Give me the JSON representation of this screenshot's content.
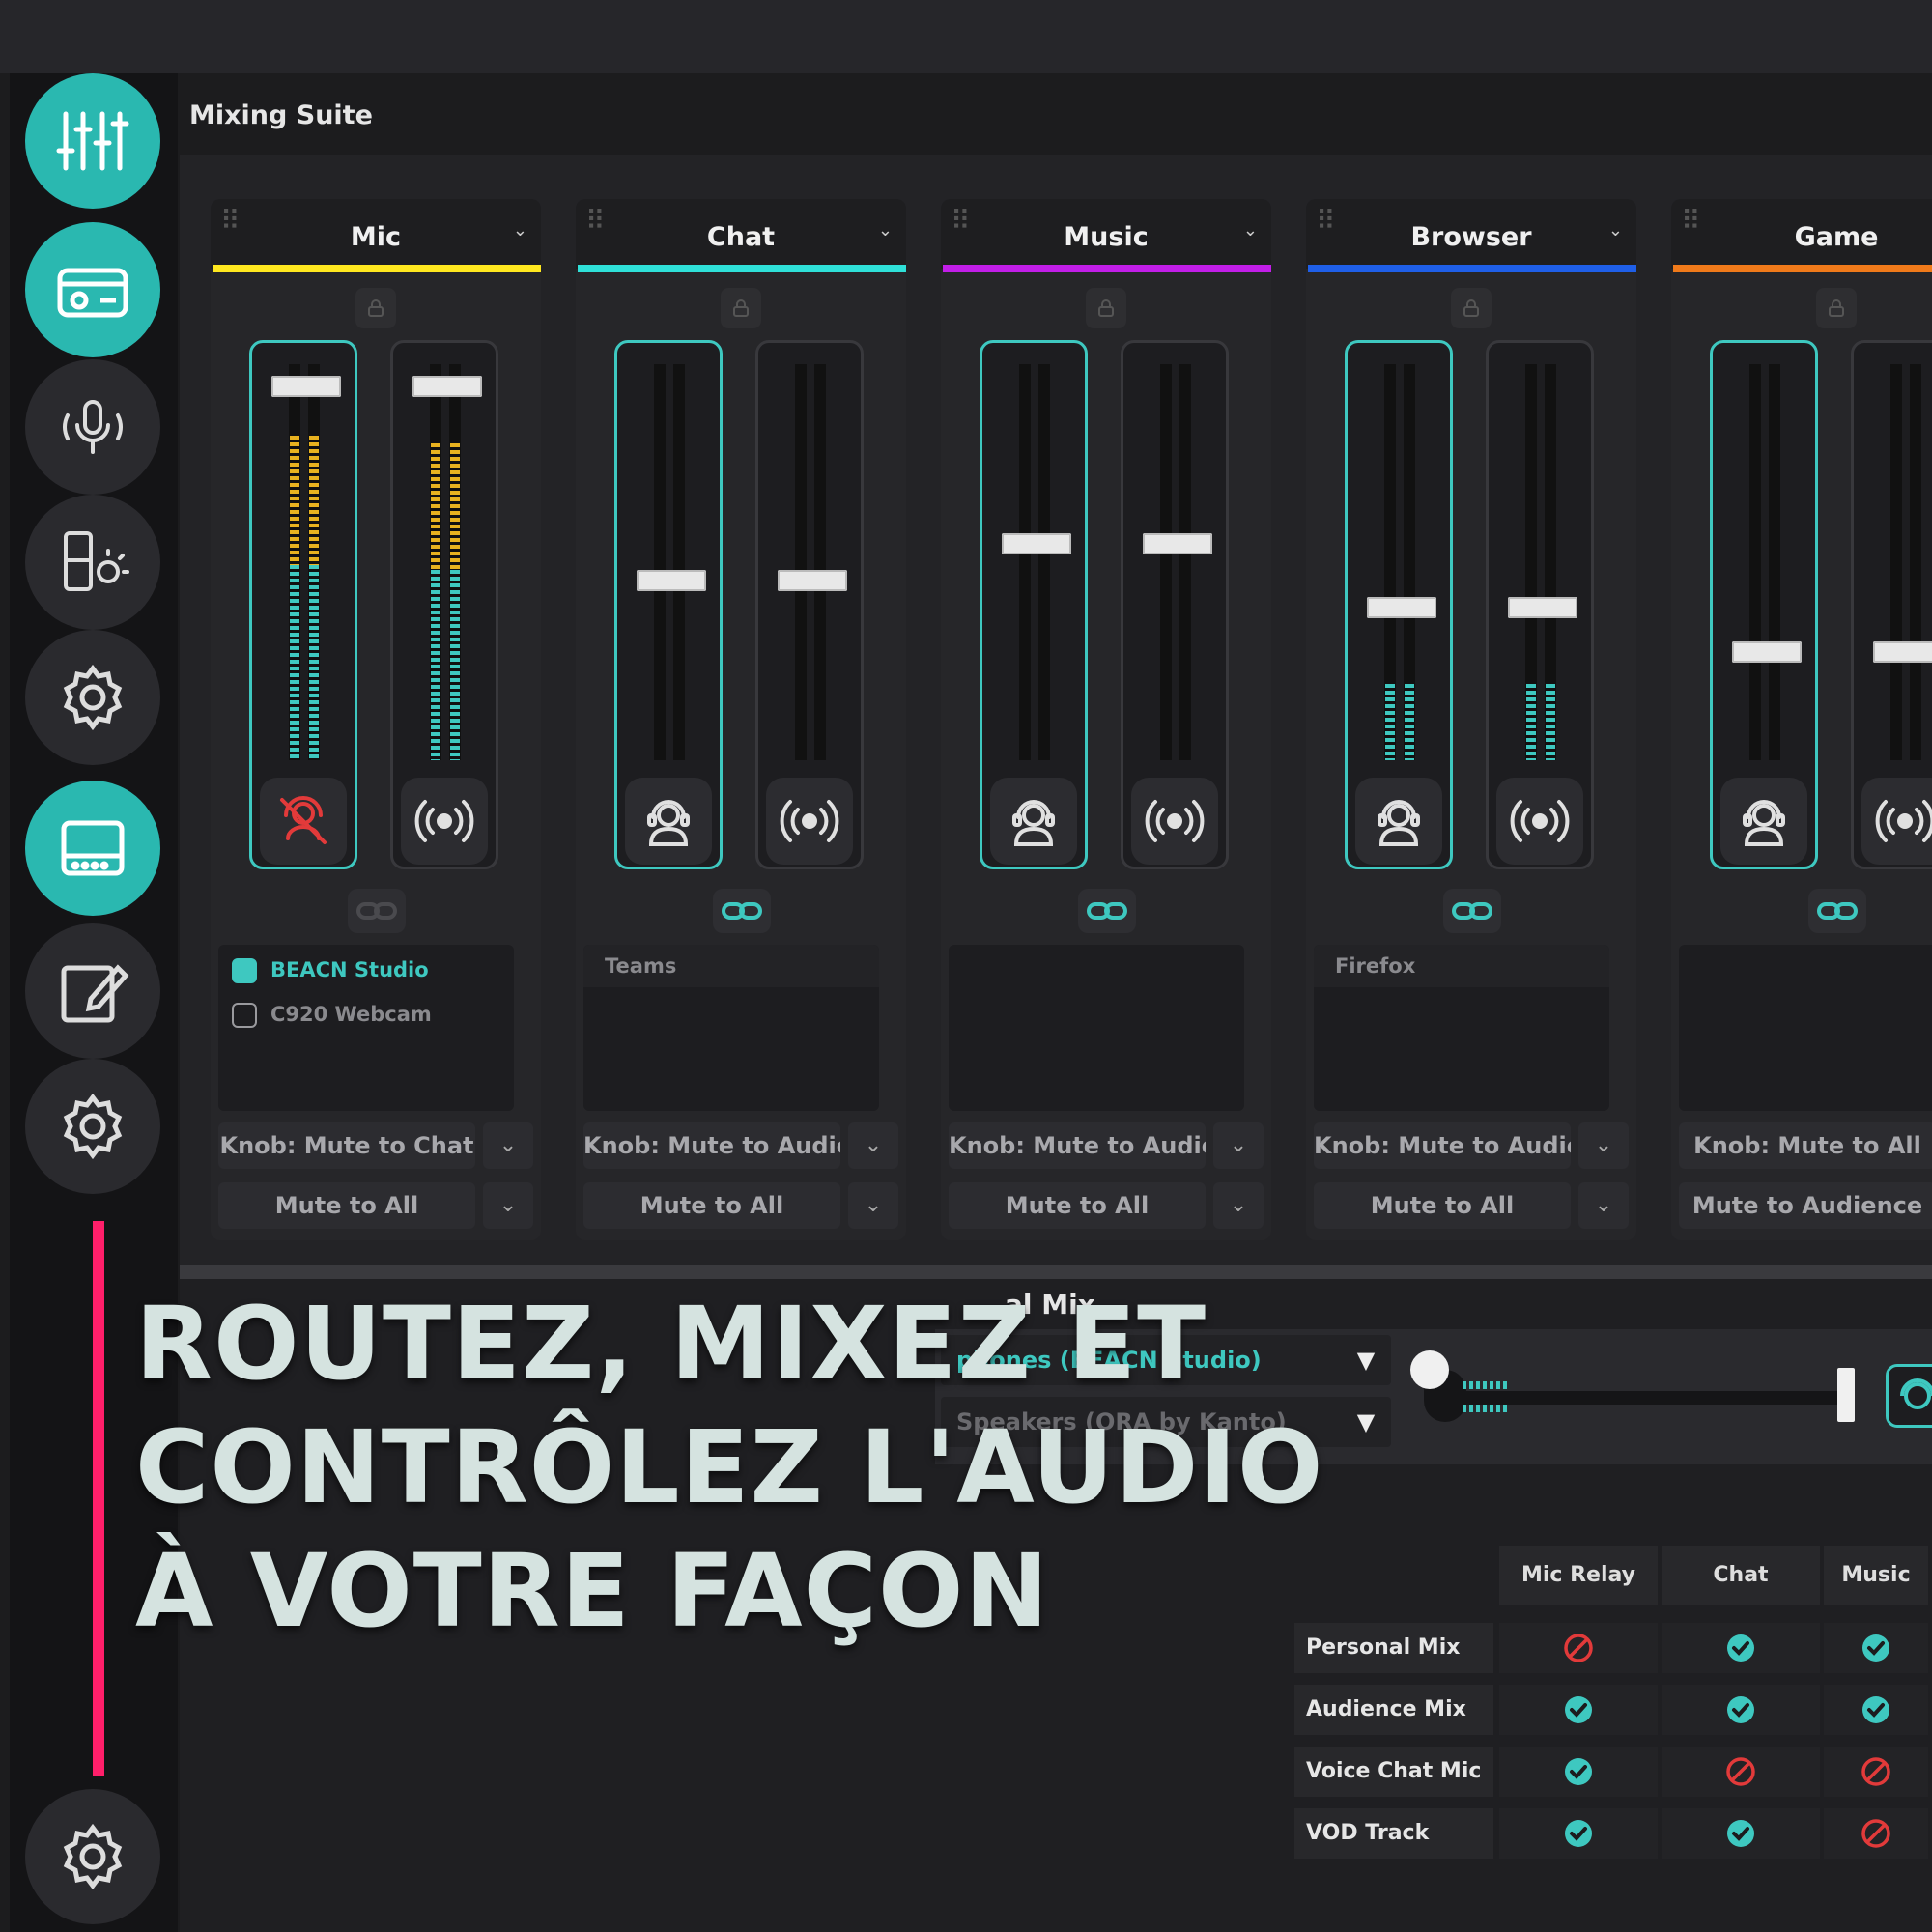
{
  "app": {
    "title": "Mixing Suite"
  },
  "colors": {
    "accent": "#3ec8c0",
    "headline_bar": "#ff1f6a",
    "mute_red": "#e23a3a"
  },
  "sidebar": {
    "items": [
      {
        "icon": "mixer-sliders-icon",
        "active": true
      },
      {
        "icon": "radio-device-icon",
        "active": true
      },
      {
        "icon": "microphone-effects-icon",
        "active": false
      },
      {
        "icon": "device-lighting-icon",
        "active": false
      },
      {
        "icon": "gear-icon",
        "active": false
      },
      {
        "icon": "hardware-device-icon",
        "active": true
      },
      {
        "icon": "edit-icon",
        "active": false
      },
      {
        "icon": "gear-icon",
        "active": false
      },
      {
        "icon": "gear-icon",
        "active": false
      }
    ]
  },
  "channels": [
    {
      "name": "Mic",
      "color": "#ffe81f",
      "fader_a": 0.97,
      "fader_b": 0.97,
      "meter_a": 0.82,
      "meter_b": 0.8,
      "a_icon": "mic-muted-icon",
      "sources": [
        {
          "label": "BEACN Studio",
          "checked": true
        },
        {
          "label": "C920 Webcam",
          "checked": false
        }
      ],
      "source_header": "",
      "knob_select": "Knob: Mute to Chat",
      "mute_select": "Mute to All",
      "linked": false
    },
    {
      "name": "Chat",
      "color": "#2fe0d8",
      "fader_a": 0.45,
      "fader_b": 0.45,
      "meter_a": 0,
      "meter_b": 0,
      "a_icon": "headphones-user-icon",
      "sources": [],
      "source_header": "Teams",
      "knob_select": "Knob: Mute to Audience",
      "mute_select": "Mute to All",
      "linked": true
    },
    {
      "name": "Music",
      "color": "#c21ee8",
      "fader_a": 0.55,
      "fader_b": 0.55,
      "meter_a": 0,
      "meter_b": 0,
      "a_icon": "headphones-user-icon",
      "sources": [],
      "source_header": "",
      "knob_select": "Knob: Mute to Audience",
      "mute_select": "Mute to All",
      "linked": true
    },
    {
      "name": "Browser",
      "color": "#1f5fe8",
      "fader_a": 0.38,
      "fader_b": 0.38,
      "meter_a": 0.32,
      "meter_b": 0.32,
      "a_icon": "headphones-user-icon",
      "sources": [],
      "source_header": "Firefox",
      "knob_select": "Knob: Mute to Audience",
      "mute_select": "Mute to All",
      "linked": true
    },
    {
      "name": "Game",
      "color": "#f07a1a",
      "fader_a": 0.26,
      "fader_b": 0.26,
      "meter_a": 0,
      "meter_b": 0,
      "a_icon": "headphones-user-icon",
      "sources": [],
      "source_header": "",
      "knob_select": "Knob: Mute to All",
      "mute_select": "Mute to Audience",
      "linked": true
    }
  ],
  "personal_mix": {
    "label_fragment": "al Mix",
    "output_1": "phones (BEACN Studio)",
    "output_2": "Speakers (ORA by Kanto)",
    "meter_level": 0.2
  },
  "routing_table": {
    "columns": [
      "Mic Relay",
      "Chat",
      "Music"
    ],
    "rows": [
      {
        "label": "Personal Mix",
        "values": [
          "off",
          "on",
          "on"
        ]
      },
      {
        "label": "Audience Mix",
        "values": [
          "on",
          "on",
          "on"
        ]
      },
      {
        "label": "Voice Chat Mic",
        "values": [
          "on",
          "off",
          "off"
        ]
      },
      {
        "label": "VOD Track",
        "values": [
          "on",
          "on",
          "off"
        ]
      }
    ]
  },
  "headline": {
    "line1": "ROUTEZ, MIXEZ ET",
    "line2": "CONTRÔLEZ L'AUDIO",
    "line3": "À VOTRE FAÇON"
  }
}
